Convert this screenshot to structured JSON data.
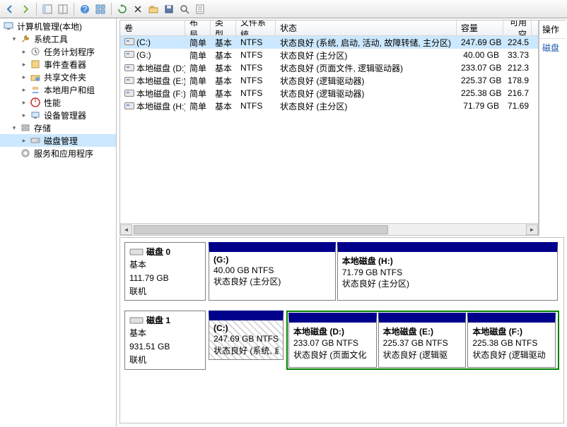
{
  "toolbar_icons": [
    "back",
    "forward",
    "sep",
    "show-hide-tree",
    "split-view",
    "sep",
    "help",
    "tile",
    "sep",
    "refresh",
    "close",
    "open",
    "save",
    "find",
    "props"
  ],
  "tree": {
    "root": "计算机管理(本地)",
    "items": [
      {
        "label": "系统工具",
        "icon": "wrench",
        "expanded": true,
        "indent": 1
      },
      {
        "label": "任务计划程序",
        "icon": "clock",
        "indent": 2
      },
      {
        "label": "事件查看器",
        "icon": "event",
        "indent": 2
      },
      {
        "label": "共享文件夹",
        "icon": "share",
        "indent": 2
      },
      {
        "label": "本地用户和组",
        "icon": "users",
        "indent": 2
      },
      {
        "label": "性能",
        "icon": "perf",
        "indent": 2
      },
      {
        "label": "设备管理器",
        "icon": "device",
        "indent": 2
      },
      {
        "label": "存储",
        "icon": "storage",
        "expanded": true,
        "indent": 1
      },
      {
        "label": "磁盘管理",
        "icon": "disk",
        "indent": 2,
        "selected": true
      },
      {
        "label": "服务和应用程序",
        "icon": "services",
        "indent": 1
      }
    ]
  },
  "columns": {
    "vol": "卷",
    "layout": "布局",
    "type": "类型",
    "fs": "文件系统",
    "status": "状态",
    "cap": "容量",
    "free": "可用空"
  },
  "volumes": [
    {
      "name": "(C:)",
      "layout": "简单",
      "type": "基本",
      "fs": "NTFS",
      "status": "状态良好 (系统, 启动, 活动, 故障转储, 主分区)",
      "cap": "247.69 GB",
      "free": "224.5",
      "selected": true
    },
    {
      "name": "(G:)",
      "layout": "简单",
      "type": "基本",
      "fs": "NTFS",
      "status": "状态良好 (主分区)",
      "cap": "40.00 GB",
      "free": "33.73"
    },
    {
      "name": "本地磁盘 (D:)",
      "layout": "简单",
      "type": "基本",
      "fs": "NTFS",
      "status": "状态良好 (页面文件, 逻辑驱动器)",
      "cap": "233.07 GB",
      "free": "212.3"
    },
    {
      "name": "本地磁盘 (E:)",
      "layout": "简单",
      "type": "基本",
      "fs": "NTFS",
      "status": "状态良好 (逻辑驱动器)",
      "cap": "225.37 GB",
      "free": "178.9"
    },
    {
      "name": "本地磁盘 (F:)",
      "layout": "简单",
      "type": "基本",
      "fs": "NTFS",
      "status": "状态良好 (逻辑驱动器)",
      "cap": "225.38 GB",
      "free": "216.7"
    },
    {
      "name": "本地磁盘 (H:)",
      "layout": "简单",
      "type": "基本",
      "fs": "NTFS",
      "status": "状态良好 (主分区)",
      "cap": "71.79 GB",
      "free": "71.69"
    }
  ],
  "actions": {
    "header": "操作",
    "link": "磁盘"
  },
  "disks": [
    {
      "title": "磁盘 0",
      "type": "基本",
      "size": "111.79 GB",
      "state": "联机",
      "parts": [
        {
          "title": "(G:)",
          "line1": "40.00 GB NTFS",
          "line2": "状态良好 (主分区)",
          "flex": 40
        },
        {
          "title": "本地磁盘   (H:)",
          "line1": "71.79 GB NTFS",
          "line2": "状态良好 (主分区)",
          "flex": 72
        }
      ]
    },
    {
      "title": "磁盘 1",
      "type": "基本",
      "size": "931.51 GB",
      "state": "联机",
      "primary": {
        "title": "(C:)",
        "line1": "247.69 GB NTFS",
        "line2": "状态良好 (系统, 启",
        "hatched": true
      },
      "extended": [
        {
          "title": "本地磁盘   (D:)",
          "line1": "233.07 GB NTFS",
          "line2": "状态良好 (页面文化"
        },
        {
          "title": "本地磁盘   (E:)",
          "line1": "225.37 GB NTFS",
          "line2": "状态良好 (逻辑驱"
        },
        {
          "title": "本地磁盘   (F:)",
          "line1": "225.38 GB NTFS",
          "line2": "状态良好 (逻辑驱动"
        }
      ]
    }
  ]
}
